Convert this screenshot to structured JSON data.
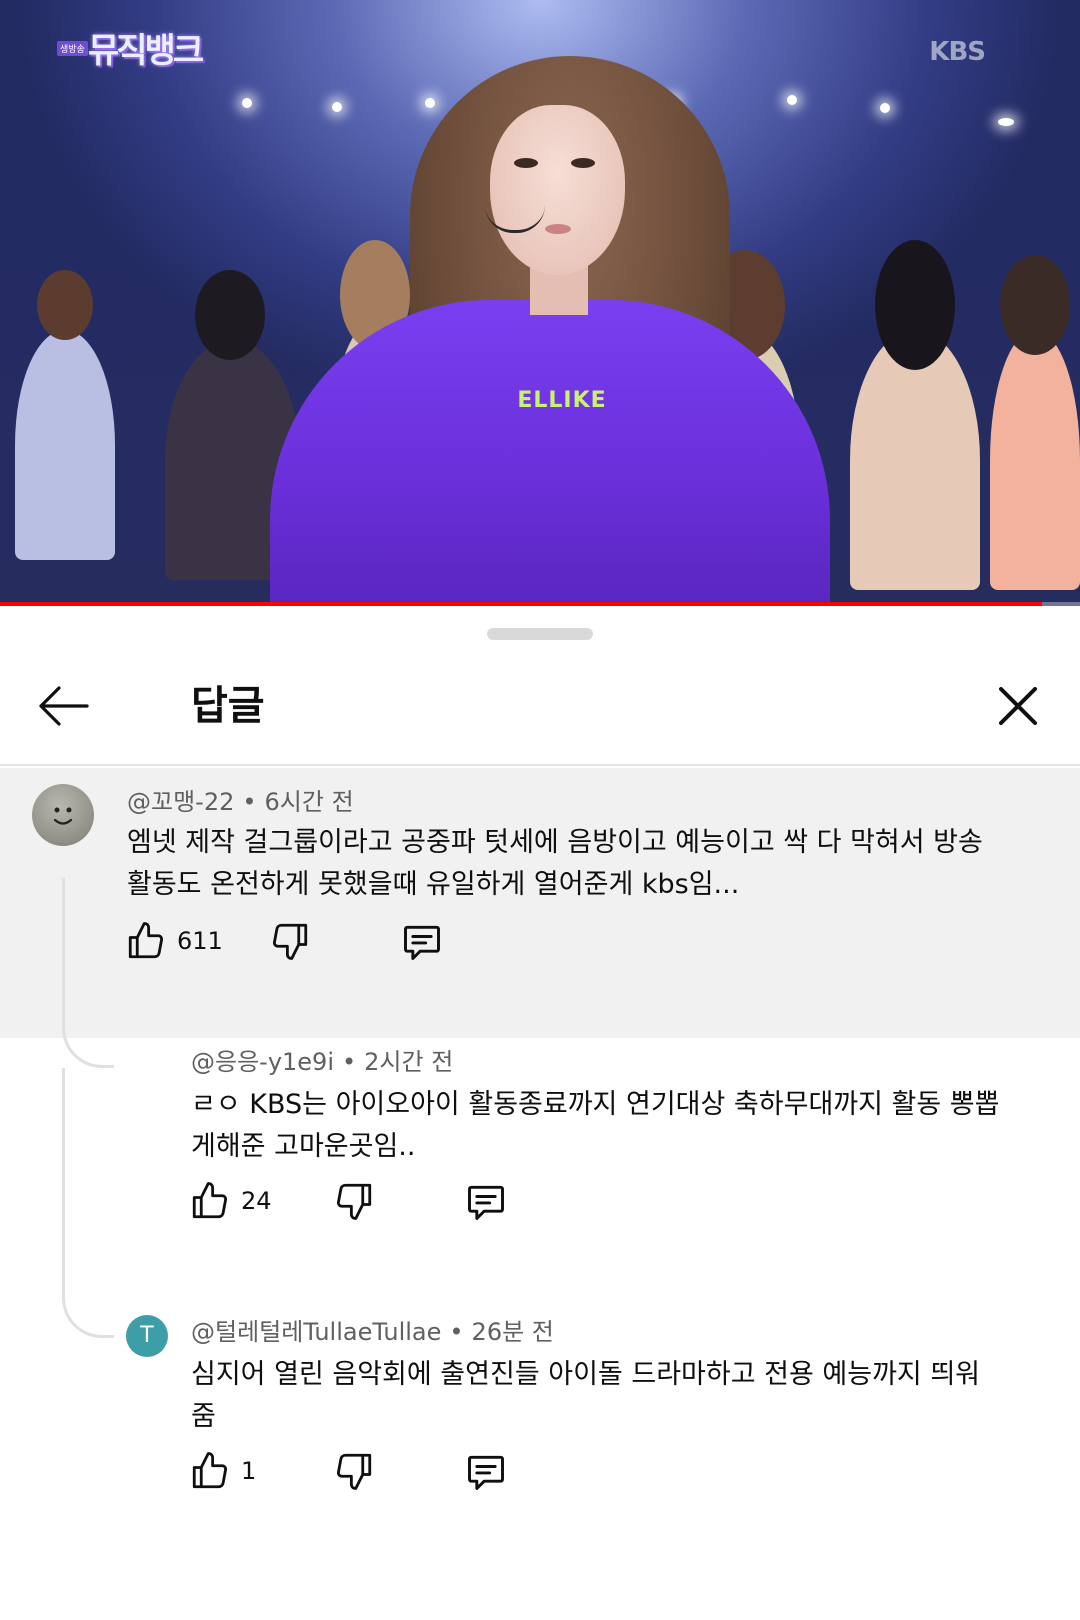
{
  "video": {
    "program_badge": "생방송",
    "program_logo": "뮤직뱅크",
    "channel_logo": "KBS",
    "shirt_text": "ELLIKE",
    "progress_fraction": 0.965
  },
  "sheet": {
    "title": "답글",
    "back_icon": "back-arrow-icon",
    "close_icon": "close-icon"
  },
  "comments": [
    {
      "author": "@꼬맹-22",
      "time": "6시간 전",
      "separator": "•",
      "text": "엠넷 제작 걸그룹이라고 공중파 텃세에 음방이고 예능이고 싹 다 막혀서 방송 활동도 온전하게 못했을때 유일하게 열어준게 kbs임...",
      "likes": "611",
      "avatar": "smiley-avatar"
    },
    {
      "author": "@응응-y1e9i",
      "time": "2시간 전",
      "separator": "•",
      "text": "ㄹㅇ KBS는 아이오아이 활동종료까지 연기대상 축하무대까지 활동 뽕뽑게해준 고마운곳임..",
      "likes": "24",
      "avatar": "none"
    },
    {
      "author": "@털레털레TullaeTullae",
      "time": "26분 전",
      "separator": "•",
      "text": "심지어 열린 음악회에 출연진들 아이돌 드라마하고 전용 예능까지 띄워줌",
      "likes": "1",
      "avatar_letter": "T",
      "avatar_color": "#3e9ea8"
    }
  ],
  "colors": {
    "accent_red": "#ff0000",
    "top_comment_bg": "#f1f1f1",
    "meta_gray": "#606060"
  }
}
